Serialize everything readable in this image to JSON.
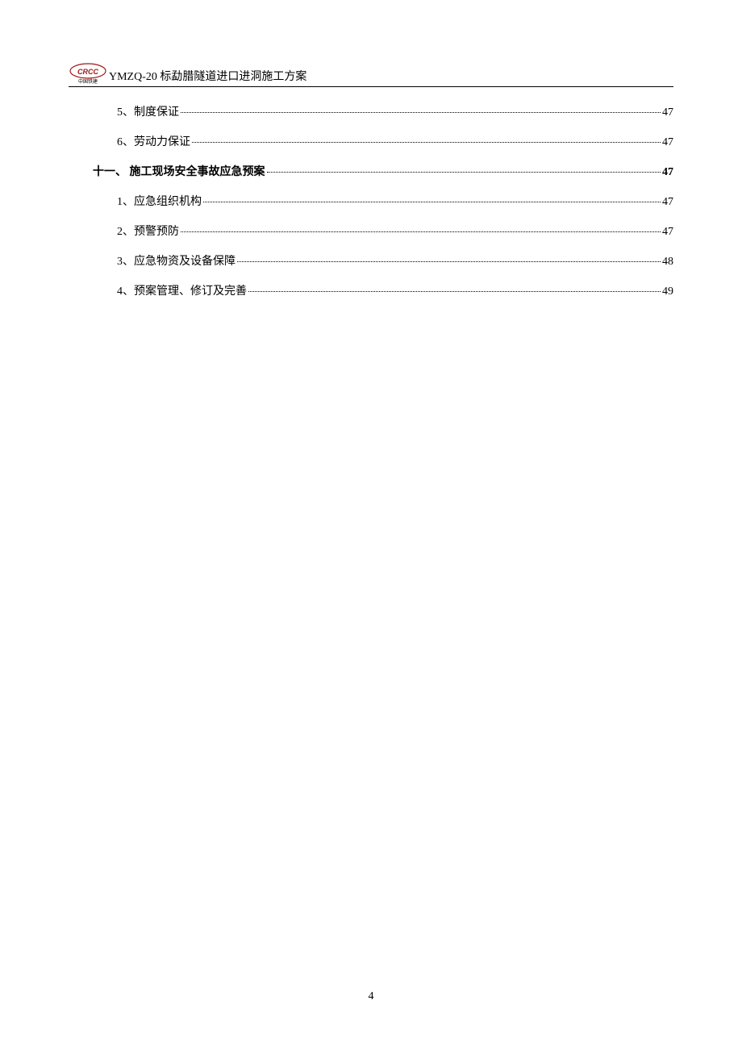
{
  "header": {
    "logo_label": "中国铁建",
    "title": "YMZQ-20 标勐腊隧道进口进洞施工方案"
  },
  "toc": [
    {
      "type": "sub",
      "label": "5、制度保证",
      "page": "47"
    },
    {
      "type": "sub",
      "label": "6、劳动力保证",
      "page": "47"
    },
    {
      "type": "section",
      "label": "十一、 施工现场安全事故应急预案",
      "page": "47"
    },
    {
      "type": "sub",
      "label": "1、应急组织机构",
      "page": "47"
    },
    {
      "type": "sub",
      "label": "2、预警预防",
      "page": "47"
    },
    {
      "type": "sub",
      "label": "3、应急物资及设备保障",
      "page": "48"
    },
    {
      "type": "sub",
      "label": "4、预案管理、修订及完善",
      "page": "49"
    }
  ],
  "page_number": "4"
}
